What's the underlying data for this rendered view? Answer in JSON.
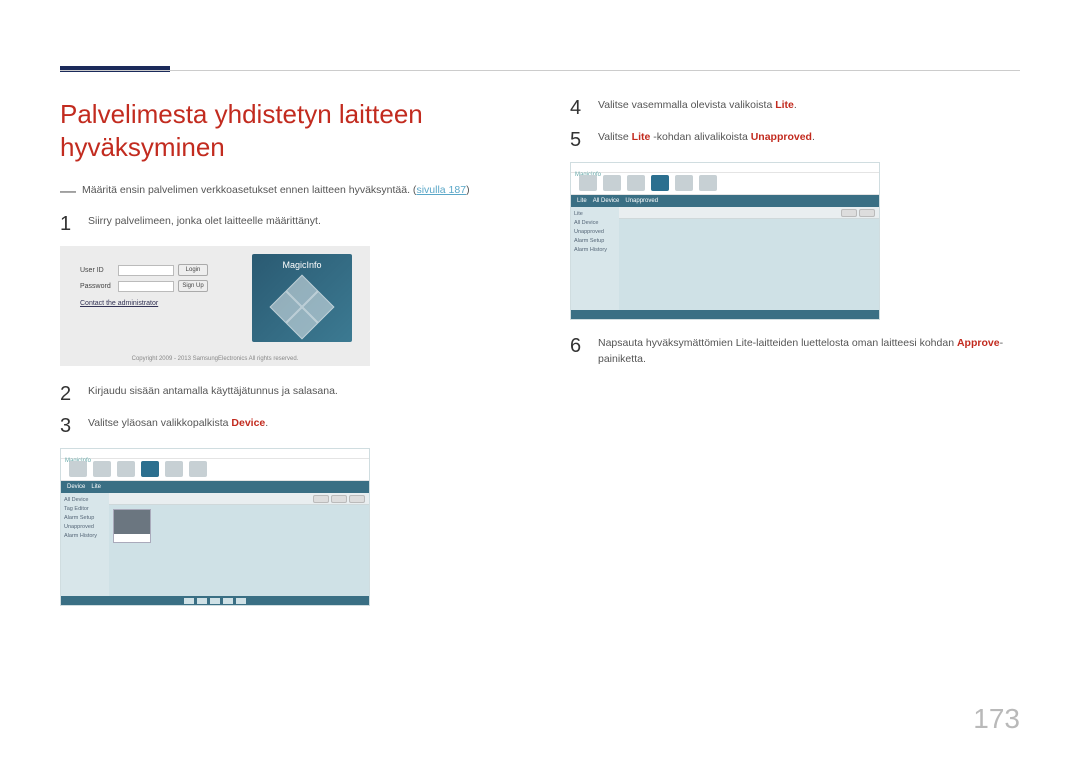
{
  "page_number": "173",
  "title": "Palvelimesta yhdistetyn laitteen hyväksyminen",
  "note": {
    "text_a": "Määritä ensin palvelimen verkkoasetukset ennen laitteen hyväksyntää. (",
    "link": "sivulla 187",
    "text_b": ")"
  },
  "left_steps": {
    "s1": {
      "num": "1",
      "text": "Siirry palvelimeen, jonka olet laitteelle määrittänyt."
    },
    "s2": {
      "num": "2",
      "text": "Kirjaudu sisään antamalla käyttäjätunnus ja salasana."
    },
    "s3": {
      "num": "3",
      "pre": "Valitse yläosan valikkopalkista ",
      "hl": "Device",
      "post": "."
    }
  },
  "right_steps": {
    "s4": {
      "num": "4",
      "pre": "Valitse vasemmalla olevista valikoista ",
      "hl": "Lite",
      "post": "."
    },
    "s5": {
      "num": "5",
      "pre": "Valitse ",
      "hl1": "Lite",
      "mid": " -kohdan alivalikoista ",
      "hl2": "Unapproved",
      "post": "."
    },
    "s6": {
      "num": "6",
      "pre": "Napsauta hyväksymättömien Lite-laitteiden luettelosta oman laitteesi kohdan ",
      "hl": "Approve",
      "post": "-painiketta."
    }
  },
  "fig1": {
    "user_label": "User ID",
    "pwd_label": "Password",
    "login_btn": "Login",
    "signup_btn": "Sign Up",
    "contact": "Contact the administrator",
    "brand": "MagicInfo",
    "copyright": "Copyright 2009 - 2013 SamsungElectronics All rights reserved."
  },
  "fig_app": {
    "brand": "MagicInfo",
    "sub_device": "Device",
    "sub_lite": "Lite",
    "side_items": [
      "All Device",
      "Tag Editor",
      "Alarm Setup",
      "Unapproved",
      "Alarm History"
    ]
  }
}
